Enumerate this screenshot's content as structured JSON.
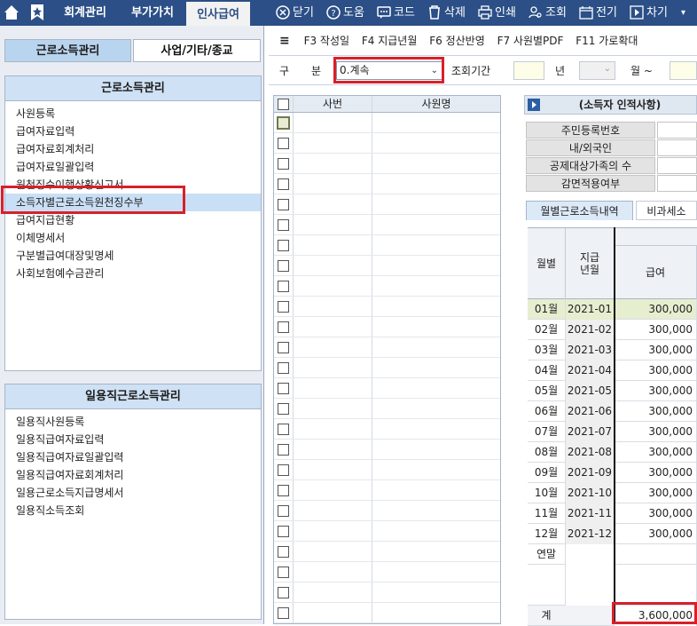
{
  "topbar": {
    "tabs": [
      {
        "label": "회계관리",
        "active": false
      },
      {
        "label": "부가가치",
        "active": false
      },
      {
        "label": "인사급여",
        "active": true
      }
    ],
    "tools": [
      {
        "label": "닫기",
        "icon": "close-circle-icon"
      },
      {
        "label": "도움",
        "icon": "help-circle-icon"
      },
      {
        "label": "코드",
        "icon": "code-chat-icon"
      },
      {
        "label": "삭제",
        "icon": "trash-icon"
      },
      {
        "label": "인쇄",
        "icon": "printer-icon"
      },
      {
        "label": "조회",
        "icon": "search-user-icon"
      },
      {
        "label": "전기",
        "icon": "calendar-icon"
      },
      {
        "label": "차기",
        "icon": "next-icon"
      }
    ]
  },
  "left": {
    "subtabs": [
      "근로소득관리",
      "사업/기타/종교"
    ],
    "section1": {
      "title": "근로소득관리",
      "items": [
        "사원등록",
        "급여자료입력",
        "급여자료회계처리",
        "급여자료일괄입력",
        "원천징수이행상황신고서",
        "소득자별근로소득원천징수부",
        "급여지급현황",
        "이체명세서",
        "구분별급여대장및명세",
        "사회보험예수금관리"
      ],
      "selected_index": 5
    },
    "section2": {
      "title": "일용직근로소득관리",
      "items": [
        "일용직사원등록",
        "일용직급여자료입력",
        "일용직급여자료일괄입력",
        "일용직급여자료회계처리",
        "일용근로소득지급명세서",
        "일용직소득조회"
      ]
    }
  },
  "fbar": [
    "F3 작성일",
    "F4 지급년월",
    "F6 정산반영",
    "F7 사원별PDF",
    "F11 가로확대"
  ],
  "filter": {
    "label_gu": "구",
    "label_bun": "분",
    "select_value": "0.계속",
    "period_label": "조회기간",
    "year_label": "년",
    "month_label": "월 ~"
  },
  "grid": {
    "headers": [
      "사번",
      "사원명"
    ],
    "rows": 25
  },
  "right": {
    "title": "(소득자 인적사항)",
    "fields": [
      "주민등록번호",
      "내/외국인",
      "공제대상가족의 수",
      "감면적용여부"
    ],
    "tabs": [
      "월별근로소득내역",
      "비과세소"
    ],
    "table": {
      "header_month": "월별",
      "header_paydate": "지급년월",
      "header_salary": "급여",
      "rows": [
        {
          "month": "01월",
          "ym": "2021-01",
          "salary": "300,000"
        },
        {
          "month": "02월",
          "ym": "2021-02",
          "salary": "300,000"
        },
        {
          "month": "03월",
          "ym": "2021-03",
          "salary": "300,000"
        },
        {
          "month": "04월",
          "ym": "2021-04",
          "salary": "300,000"
        },
        {
          "month": "05월",
          "ym": "2021-05",
          "salary": "300,000"
        },
        {
          "month": "06월",
          "ym": "2021-06",
          "salary": "300,000"
        },
        {
          "month": "07월",
          "ym": "2021-07",
          "salary": "300,000"
        },
        {
          "month": "08월",
          "ym": "2021-08",
          "salary": "300,000"
        },
        {
          "month": "09월",
          "ym": "2021-09",
          "salary": "300,000"
        },
        {
          "month": "10월",
          "ym": "2021-10",
          "salary": "300,000"
        },
        {
          "month": "11월",
          "ym": "2021-11",
          "salary": "300,000"
        },
        {
          "month": "12월",
          "ym": "2021-12",
          "salary": "300,000"
        }
      ],
      "yearend_label": "연말",
      "total_label": "계",
      "total_value": "3,600,000"
    }
  },
  "colors": {
    "topbar": "#2b4f86",
    "highlight_red": "#d8202a",
    "selected_row": "#c9dff5"
  }
}
